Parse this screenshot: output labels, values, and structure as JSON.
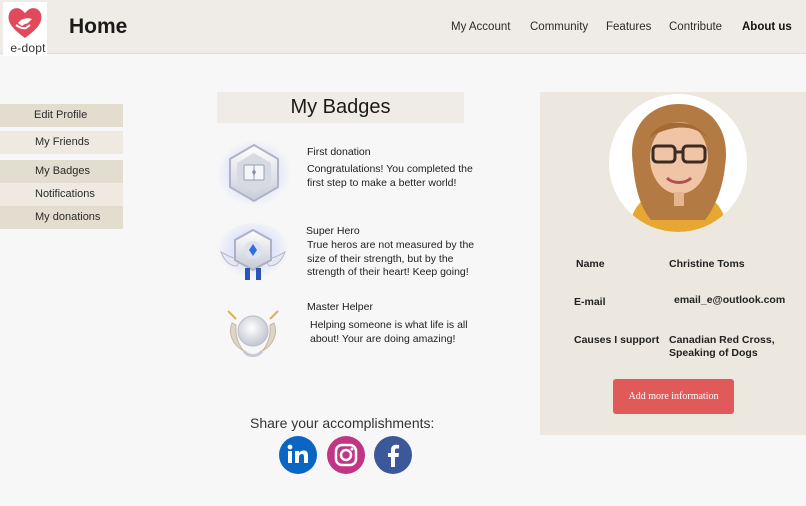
{
  "brand": {
    "logo_text": "e-dopt"
  },
  "header": {
    "title": "Home",
    "nav": [
      {
        "label": "My Account"
      },
      {
        "label": "Community"
      },
      {
        "label": "Features"
      },
      {
        "label": "Contribute"
      },
      {
        "label": "About us"
      }
    ]
  },
  "sidebar": {
    "items": [
      {
        "label": "Edit Profile"
      },
      {
        "label": "My Friends"
      },
      {
        "label": "My Badges"
      },
      {
        "label": "Notifications"
      },
      {
        "label": "My donations"
      }
    ]
  },
  "badges": {
    "title": "My Badges",
    "items": [
      {
        "title": "First donation",
        "desc1": "Congratulations! You completed the",
        "desc2": "first step to make a better world!",
        "icon": "book-badge-icon"
      },
      {
        "title": "Super Hero",
        "desc1": "True heros are not measured by the",
        "desc2": "size of their strength, but by the",
        "desc3": "strength of their heart! Keep going!",
        "icon": "hero-badge-icon"
      },
      {
        "title": "Master Helper",
        "desc1": "Helping someone is what life is all",
        "desc2": "about! Your are doing amazing!",
        "icon": "laurel-badge-icon"
      }
    ]
  },
  "share": {
    "label": "Share your accomplishments:",
    "networks": [
      "linkedin-icon",
      "instagram-icon",
      "facebook-icon"
    ]
  },
  "profile": {
    "name_label": "Name",
    "name_value": "Christine Toms",
    "email_label": "E-mail",
    "email_value": "email_e@outlook.com",
    "causes_label": "Causes I support",
    "causes_value_1": "Canadian Red Cross,",
    "causes_value_2": "Speaking of Dogs",
    "button_label": "Add more information"
  },
  "colors": {
    "accent": "#e05a5a",
    "panel": "#ece7df",
    "header": "#efece7",
    "linkedin": "#0a66c2",
    "instagram": "#c13584",
    "facebook": "#3b5998"
  }
}
